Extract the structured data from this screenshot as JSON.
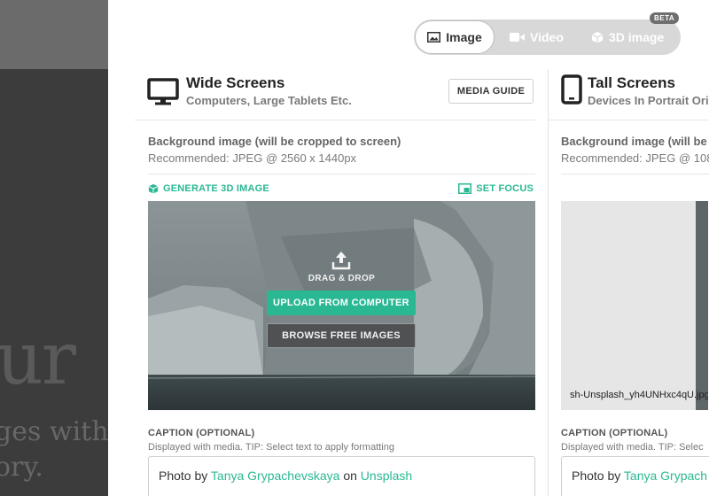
{
  "background": {
    "big_text": "ur",
    "line1": "ges with",
    "line2": "ory."
  },
  "media_tabs": {
    "image": "Image",
    "video": "Video",
    "three_d": "3D image",
    "beta": "BETA",
    "active": "image"
  },
  "wide": {
    "title": "Wide Screens",
    "subtitle": "Computers, Large Tablets Etc.",
    "media_guide": "MEDIA GUIDE",
    "bg_label": "Background image (will be cropped to screen)",
    "bg_rec": "Recommended: JPEG @ 2560 x 1440px",
    "generate_3d": "GENERATE 3D IMAGE",
    "set_focus": "SET FOCUS",
    "drag_drop": "DRAG & DROP",
    "upload": "UPLOAD FROM COMPUTER",
    "browse": "BROWSE FREE IMAGES",
    "caption_label": "CAPTION (OPTIONAL)",
    "caption_tip": "Displayed with media. TIP: Select text to apply formatting",
    "caption": {
      "prefix": "Photo by ",
      "author": "Tanya Grypachevskaya",
      "middle": " on ",
      "source": "Unsplash"
    }
  },
  "tall": {
    "title": "Tall Screens",
    "subtitle": "Devices In Portrait Ori",
    "bg_label": "Background image (will be",
    "bg_rec": "Recommended: JPEG @ 108",
    "filename": "sh-Unsplash_yh4UNHxc4qU.jpg",
    "caption_label": "CAPTION (OPTIONAL)",
    "caption_tip": "Displayed with media. TIP: Selec",
    "caption": {
      "prefix": "Photo by ",
      "author": "Tanya Grypach"
    }
  },
  "colors": {
    "accent": "#2ab893",
    "overlay": "#4a4a4a"
  }
}
